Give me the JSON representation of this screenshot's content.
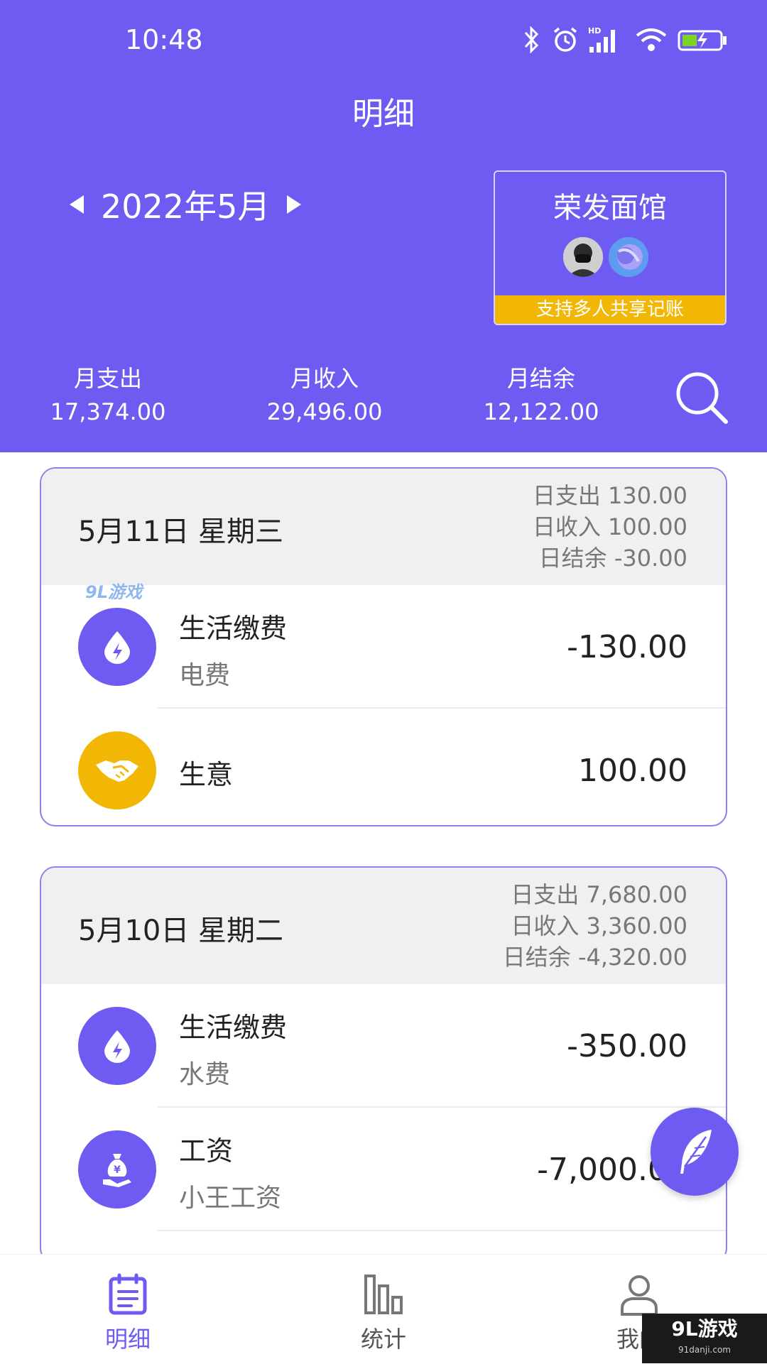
{
  "status_bar": {
    "time": "10:48",
    "hd_badge": "HD"
  },
  "header": {
    "title": "明细"
  },
  "month_nav": {
    "label": "2022年5月"
  },
  "ledger": {
    "name": "荣发面馆",
    "banner": "支持多人共享记账"
  },
  "summary": {
    "expense_label": "月支出",
    "expense_value": "17,374.00",
    "income_label": "月收入",
    "income_value": "29,496.00",
    "balance_label": "月结余",
    "balance_value": "12,122.00"
  },
  "days": [
    {
      "date": "5月11日  星期三",
      "expense": "日支出 130.00",
      "income": "日收入 100.00",
      "balance": "日结余 -30.00",
      "transactions": [
        {
          "title": "生活缴费",
          "subtitle": "电费",
          "amount": "-130.00",
          "icon": "utility-drop-icon",
          "color": "#6e5cf2"
        },
        {
          "title": "生意",
          "subtitle": "",
          "amount": "100.00",
          "icon": "handshake-icon",
          "color": "#f2b705"
        }
      ]
    },
    {
      "date": "5月10日  星期二",
      "expense": "日支出 7,680.00",
      "income": "日收入 3,360.00",
      "balance": "日结余 -4,320.00",
      "transactions": [
        {
          "title": "生活缴费",
          "subtitle": "水费",
          "amount": "-350.00",
          "icon": "utility-drop-icon",
          "color": "#6e5cf2"
        },
        {
          "title": "工资",
          "subtitle": "小王工资",
          "amount": "-7,000.00",
          "icon": "money-bag-icon",
          "color": "#6e5cf2"
        }
      ]
    }
  ],
  "tabs": [
    {
      "label": "明细",
      "active": true
    },
    {
      "label": "统计",
      "active": false
    },
    {
      "label": "我的",
      "active": false
    }
  ],
  "watermark": {
    "main": "9L游戏",
    "url": "91danji.com",
    "top": "9L游戏"
  },
  "colors": {
    "primary": "#6e5cf2",
    "accent": "#f2b705",
    "header_text": "#ffffff"
  }
}
